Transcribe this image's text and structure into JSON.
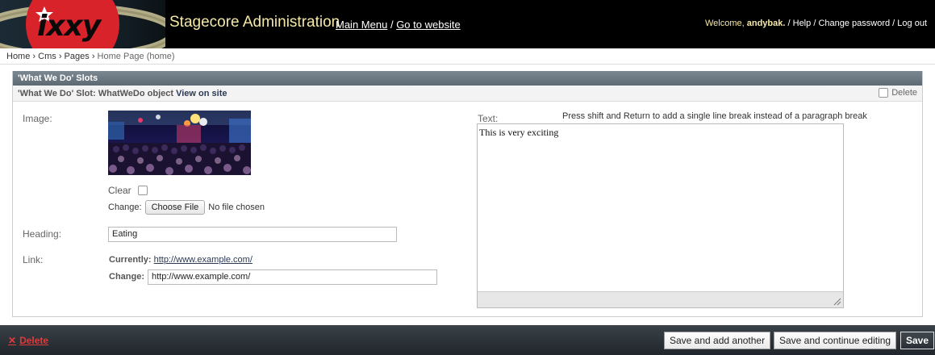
{
  "header": {
    "logo_text": "ixxy",
    "title": "Stagecore Administration",
    "main_menu": "Main Menu",
    "separator": "/",
    "go_to_website": "Go to website"
  },
  "user_tools": {
    "welcome": "Welcome,",
    "username": "andybak.",
    "sep": "/",
    "help": "Help",
    "change_password": "Change password",
    "log_out": "Log out"
  },
  "breadcrumbs": {
    "home": "Home",
    "cms": "Cms",
    "pages": "Pages",
    "current": "Home Page (home)",
    "sep": "›"
  },
  "inline": {
    "group_title": "'What We Do' Slots",
    "slot_prefix": "'What We Do' Slot: WhatWeDo object",
    "view_on_site": "View on site",
    "delete_label": "Delete"
  },
  "form": {
    "image_label": "Image:",
    "clear_label": "Clear",
    "change_label": "Change:",
    "choose_file": "Choose File",
    "no_file": "No file chosen",
    "heading_label": "Heading:",
    "heading_value": "Eating",
    "link_label": "Link:",
    "currently_label": "Currently:",
    "currently_value": "http://www.example.com/",
    "link_change_label": "Change:",
    "link_value": "http://www.example.com/",
    "text_label": "Text:",
    "text_hint": "Press shift and Return to add a single line break instead of a paragraph break",
    "text_value": "This is very exciting"
  },
  "submit_row": {
    "delete": "Delete",
    "save_add_another": "Save and add another",
    "save_continue": "Save and continue editing",
    "save": "Save"
  },
  "colors": {
    "header_bg": "#000000",
    "title": "#f5e9a8",
    "delete_red": "#e23a3a"
  }
}
